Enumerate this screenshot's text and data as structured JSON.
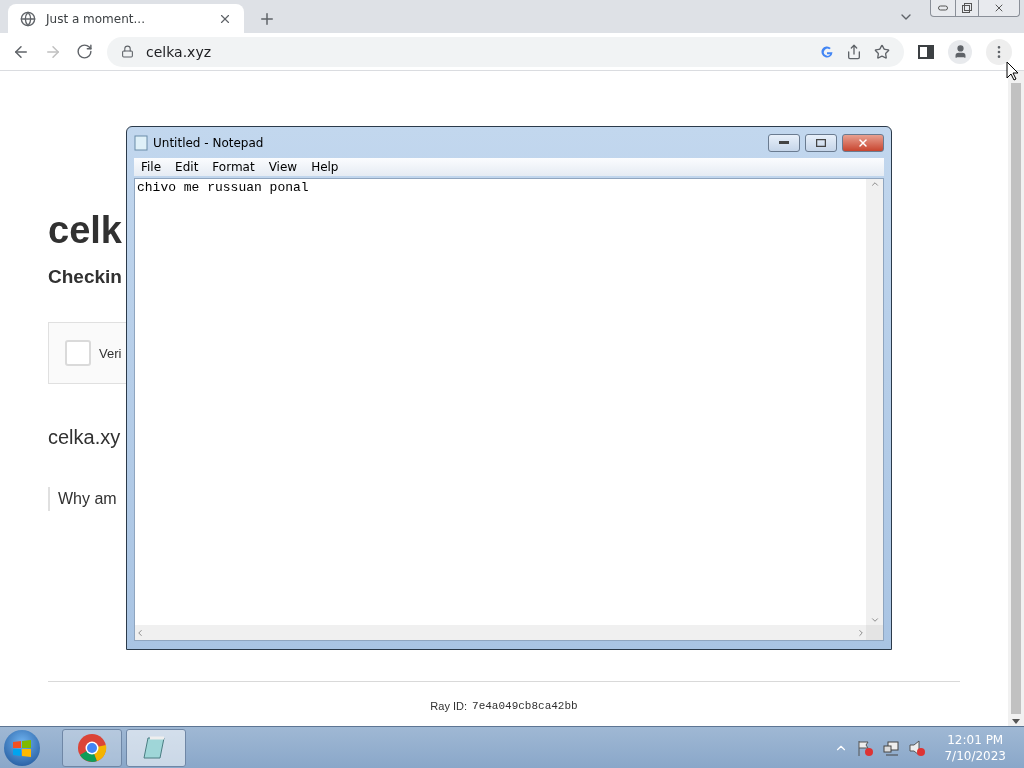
{
  "browser": {
    "tabs": [
      {
        "title": "Just a moment...",
        "selected": true
      }
    ],
    "address": "celka.xyz"
  },
  "page": {
    "heading": "celk",
    "subheading": "Checkin",
    "verify": {
      "label": "Veri",
      "checked": false
    },
    "domain": "celka.xy",
    "why": "Why am",
    "ray_label": "Ray ID:",
    "ray_id": "7e4a049cb8ca42bb"
  },
  "notepad": {
    "title": "Untitled - Notepad",
    "menu": [
      "File",
      "Edit",
      "Format",
      "View",
      "Help"
    ],
    "text": "chivo me russuan ponal"
  },
  "taskbar": {
    "apps": [
      {
        "kind": "chrome",
        "selected": false
      },
      {
        "kind": "notepad",
        "selected": true
      }
    ],
    "time": "12:01 PM",
    "date": "7/10/2023"
  }
}
